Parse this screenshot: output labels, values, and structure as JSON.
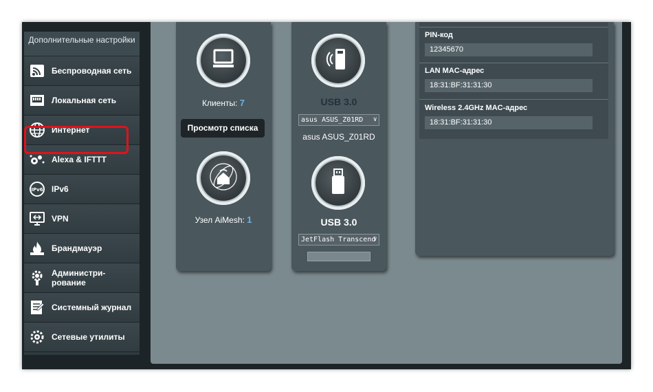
{
  "sidebar": {
    "header": "Дополнительные настройки",
    "items": [
      {
        "label": "Беспроводная сеть",
        "icon": "wireless-icon"
      },
      {
        "label": "Локальная сеть",
        "icon": "lan-icon"
      },
      {
        "label": "Интернет",
        "icon": "globe-icon"
      },
      {
        "label": "Alexa & IFTTT",
        "icon": "alexa-icon"
      },
      {
        "label": "IPv6",
        "icon": "ipv6-icon"
      },
      {
        "label": "VPN",
        "icon": "vpn-icon"
      },
      {
        "label": "Брандмауэр",
        "icon": "firewall-icon"
      },
      {
        "label": "Администри- рование",
        "icon": "gear-icon"
      },
      {
        "label": "Системный журнал",
        "icon": "log-icon"
      },
      {
        "label": "Сетевые утилиты",
        "icon": "tools-icon"
      }
    ],
    "highlight_color": "#e0131a"
  },
  "clients_card": {
    "clients_label": "Клиенты:",
    "clients_count": "7",
    "view_list_button": "Просмотр списка",
    "aimesh_label": "Узел AiMesh:",
    "aimesh_count": "1"
  },
  "usb_card": {
    "usb1_title": "USB 3.0",
    "usb1_select": "asus ASUS_Z01RD",
    "usb1_device": "asus ASUS_Z01RD",
    "usb2_title": "USB 3.0",
    "usb2_select": "JetFlash Transcend"
  },
  "info_panel": {
    "pin_label": "PIN-код",
    "pin_value": "12345670",
    "lan_mac_label": "LAN MAC-адрес",
    "lan_mac_value": "18:31:BF:31:31:30",
    "wifi_mac_label": "Wireless 2.4GHz MAC-адрес",
    "wifi_mac_value": "18:31:BF:31:31:30"
  },
  "colors": {
    "accent_count": "#6fb3e6",
    "panel": "#4a575d",
    "background": "#7b8a8f"
  }
}
